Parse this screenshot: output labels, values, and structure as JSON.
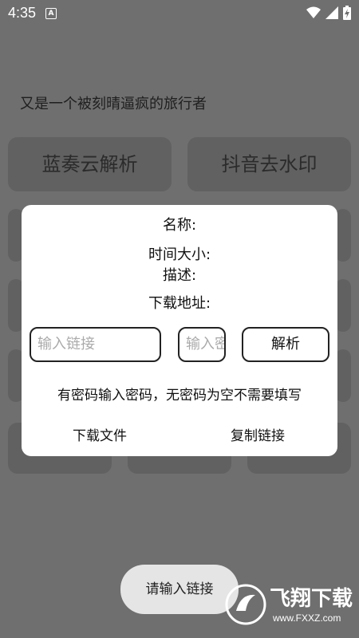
{
  "status": {
    "time": "4:35",
    "a_icon": "A"
  },
  "background": {
    "subtitle": "又是一个被刻晴逼疯的旅行者",
    "buttons": [
      "蓝奏云解析",
      "抖音去水印"
    ]
  },
  "dialog": {
    "name_label": "名称:",
    "time_size_label": "时间大小:",
    "desc_label": "描述:",
    "download_addr_label": "下载地址:",
    "link_placeholder": "输入链接",
    "password_placeholder": "输入密码",
    "parse_button": "解析",
    "hint": "有密码输入密码，无密码为空不需要填写",
    "download_file": "下载文件",
    "copy_link": "复制链接"
  },
  "toast": {
    "text": "请输入链接"
  },
  "watermark": {
    "brand": "飞翔下载",
    "url": "www.FXXZ.com"
  },
  "colors": {
    "overlay": "#6f6f6f",
    "dialog_bg": "#ffffff",
    "toast_bg": "#e5e5e5"
  }
}
